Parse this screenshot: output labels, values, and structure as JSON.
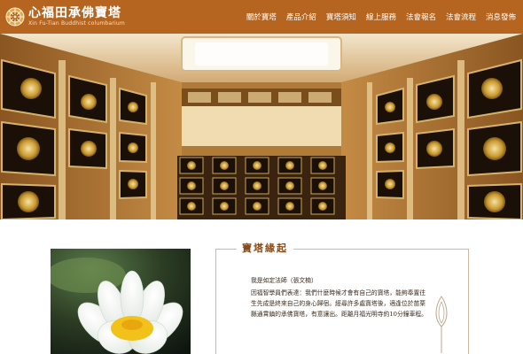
{
  "header": {
    "logo_title": "心福田承佛寶塔",
    "logo_subtitle": "Xin Fu-Tian Buddhist columbarium",
    "nav": [
      "關於寶塔",
      "產品介紹",
      "寶塔須知",
      "線上服務",
      "法會報名",
      "法會流程",
      "消息發佈"
    ]
  },
  "section": {
    "title": "寶塔緣起",
    "signature": "我是如定法師（張文楠）",
    "body": "因福智學員們表達：我們什麼時候才會有自己的寶塔，能夠奉置往生先成是終來自己的身心歸宿。經尋許多處寶塔後，適逢位於苗栗縣通霄鎮的承佛寶塔，有意讓出。距離月福光明寺約10分鐘車程。"
  },
  "colors": {
    "header_bg": "#b5651f",
    "title": "#8a4a17",
    "frame": "#cdb89c"
  }
}
